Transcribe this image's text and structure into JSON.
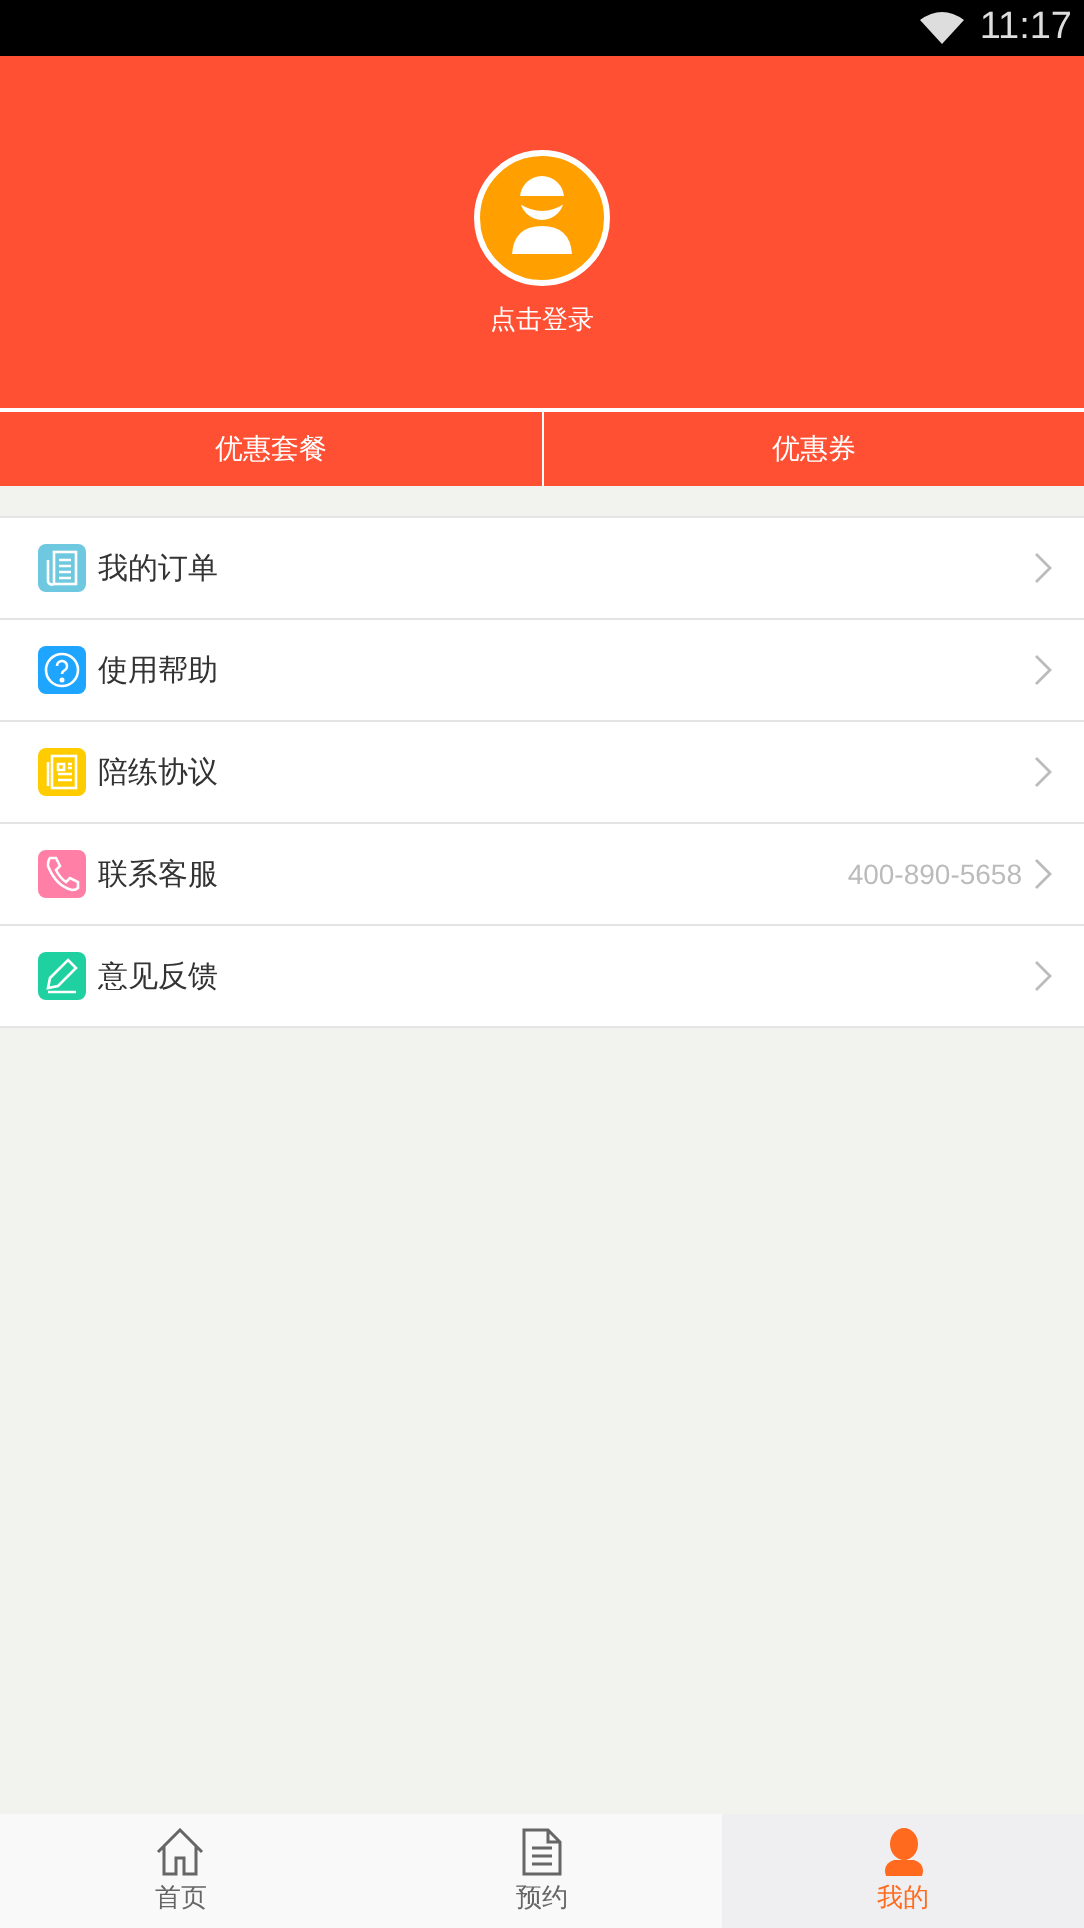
{
  "status_bar": {
    "time": "11:17"
  },
  "profile": {
    "login_label": "点击登录"
  },
  "promo_tabs": [
    {
      "label": "优惠套餐"
    },
    {
      "label": "优惠券"
    }
  ],
  "menu": [
    {
      "kind": "order",
      "color": "#6ec8e0",
      "label": "我的订单"
    },
    {
      "kind": "help",
      "color": "#1ea5ff",
      "label": "使用帮助"
    },
    {
      "kind": "agreement",
      "color": "#ffcc00",
      "label": "陪练协议"
    },
    {
      "kind": "phone",
      "color": "#ff7fa6",
      "label": "联系客服",
      "value": "400-890-5658"
    },
    {
      "kind": "feedback",
      "color": "#1fd1a0",
      "label": "意见反馈"
    }
  ],
  "bottom_nav": [
    {
      "kind": "home",
      "label": "首页",
      "selected": false
    },
    {
      "kind": "booking",
      "label": "预约",
      "selected": false
    },
    {
      "kind": "me",
      "label": "我的",
      "selected": true
    }
  ]
}
